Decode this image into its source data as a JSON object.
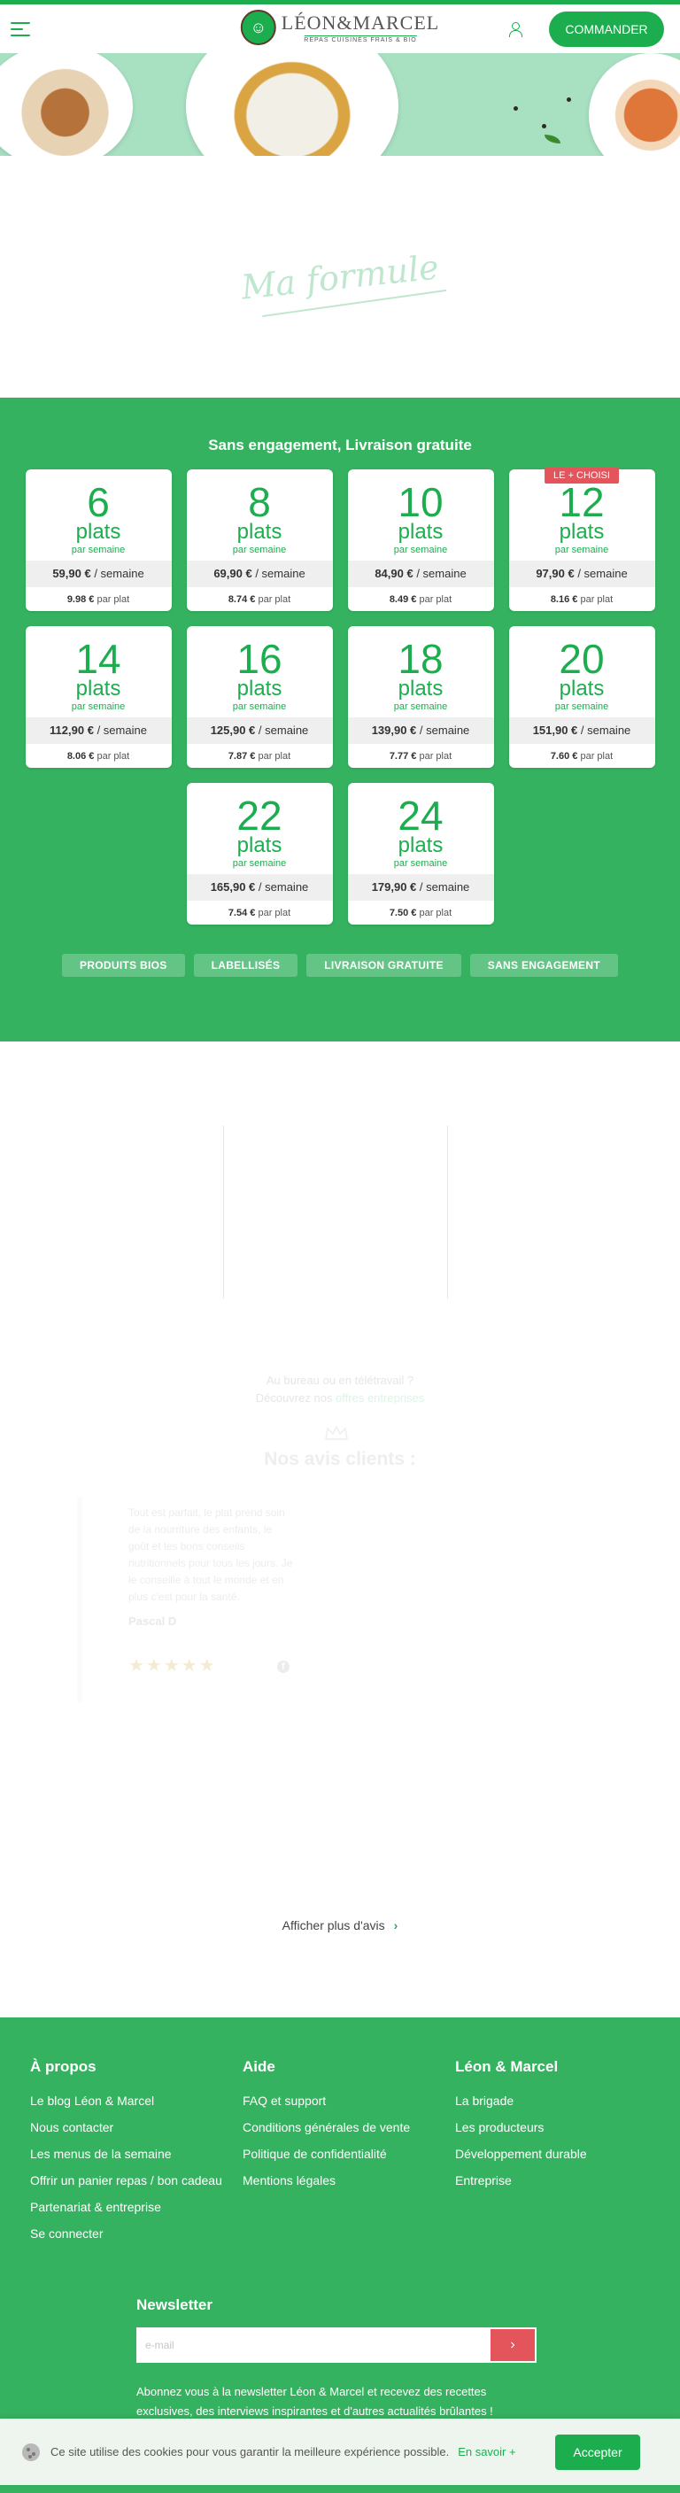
{
  "header": {
    "logo_name": "LÉON&MARCEL",
    "logo_tagline": "REPAS CUISINÉS FRAIS & BIO",
    "order_button": "COMMANDER"
  },
  "formula": {
    "title": "Ma formule"
  },
  "pricing": {
    "headline": "Sans engagement, Livraison gratuite",
    "unit_label": "plats",
    "per_label": "par semaine",
    "per_week_suffix": "/ semaine",
    "per_plate_suffix": "par plat",
    "cards": [
      {
        "count": "6",
        "price": "59,90 €",
        "unit_price": "9.98 €"
      },
      {
        "count": "8",
        "price": "69,90 €",
        "unit_price": "8.74 €"
      },
      {
        "count": "10",
        "price": "84,90 €",
        "unit_price": "8.49 €"
      },
      {
        "count": "12",
        "price": "97,90 €",
        "unit_price": "8.16 €",
        "badge": "LE + CHOISI"
      },
      {
        "count": "14",
        "price": "112,90 €",
        "unit_price": "8.06 €"
      },
      {
        "count": "16",
        "price": "125,90 €",
        "unit_price": "7.87 €"
      },
      {
        "count": "18",
        "price": "139,90 €",
        "unit_price": "7.77 €"
      },
      {
        "count": "20",
        "price": "151,90 €",
        "unit_price": "7.60 €"
      },
      {
        "count": "22",
        "price": "165,90 €",
        "unit_price": "7.54 €"
      },
      {
        "count": "24",
        "price": "179,90 €",
        "unit_price": "7.50 €"
      }
    ],
    "tags": [
      "PRODUITS BIOS",
      "LABELLISÉS",
      "LIVRAISON GRATUITE",
      "SANS ENGAGEMENT"
    ]
  },
  "office": {
    "line1": "Au bureau ou en télétravail ?",
    "line2_prefix": "Découvrez nos",
    "line2_link": "offres entreprises"
  },
  "reviews": {
    "title": "Nos avis clients :",
    "text": "Tout est parfait, le plat prend soin de la nourriture des enfants, le goût et les bons conseils nutritionnels pour tous les jours. Je le conseille à tout le monde et en plus c'est pour la santé.",
    "author": "Pascal D",
    "stars": "★★★★★",
    "more": "Afficher plus d'avis"
  },
  "footer": {
    "columns": [
      {
        "title": "À propos",
        "links": [
          "Le blog Léon & Marcel",
          "Nous contacter",
          "Les menus de la semaine",
          "Offrir un panier repas / bon cadeau",
          "Partenariat & entreprise",
          "Se connecter"
        ]
      },
      {
        "title": "Aide",
        "links": [
          "FAQ et support",
          "Conditions générales de vente",
          "Politique de confidentialité",
          "Mentions légales"
        ]
      },
      {
        "title": "Léon & Marcel",
        "links": [
          "La brigade",
          "Les producteurs",
          "Développement durable",
          "Entreprise"
        ]
      }
    ],
    "newsletter": {
      "title": "Newsletter",
      "placeholder": "e-mail",
      "button": "›",
      "description": "Abonnez vous à la newsletter Léon & Marcel et recevez des recettes exclusives, des interviews inspirantes et d'autres actualités brûlantes !"
    }
  },
  "cookie": {
    "text": "Ce site utilise des cookies pour vous garantir la meilleure expérience possible.",
    "more": "En savoir +",
    "accept": "Accepter"
  },
  "colors": {
    "brand_green": "#1cae4e",
    "section_green": "#35b25f",
    "badge_red": "#e4545b"
  }
}
